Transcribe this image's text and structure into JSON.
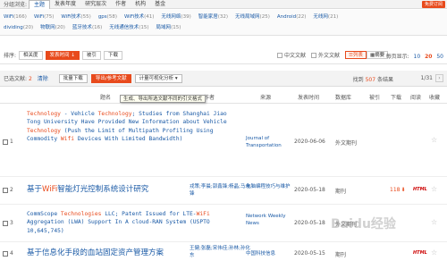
{
  "group_bar": {
    "label": "分组浏览:",
    "tabs": [
      "主题",
      "发表年度",
      "研究层次",
      "作者",
      "机构",
      "基金"
    ],
    "active": 0,
    "free_ordering": "免费订阅"
  },
  "facets": [
    [
      {
        "name": "WiFi",
        "count": "(166)"
      },
      {
        "name": "WiFi",
        "count": "(75)"
      },
      {
        "name": "WiFi技术",
        "count": "(55)"
      },
      {
        "name": "gps",
        "count": "(58)"
      },
      {
        "name": "WiFi技术",
        "count": "(41)"
      },
      {
        "name": "无线网络",
        "count": "(39)"
      },
      {
        "name": "智能家居",
        "count": "(32)"
      },
      {
        "name": "无线局域网",
        "count": "(25)"
      },
      {
        "name": "Android",
        "count": "(22)"
      },
      {
        "name": "无线网",
        "count": "(21)"
      }
    ],
    [
      {
        "name": "dividing",
        "count": "(20)"
      },
      {
        "name": "物联网",
        "count": "(20)"
      },
      {
        "name": "蓝牙技术",
        "count": "(16)"
      },
      {
        "name": "无线通信技术",
        "count": "(15)"
      },
      {
        "name": "局域网",
        "count": "(15)"
      }
    ]
  ],
  "sort_bar": {
    "label": "排序:",
    "buttons": [
      "相关度",
      "发表时间",
      "被引",
      "下载"
    ],
    "active": 1,
    "chinese_docs": "中文文献",
    "foreign_docs": "外文文献",
    "view_list": "列表",
    "view_abstract": "摘要",
    "per_page_label": "每页显示:",
    "per_page_options": [
      "10",
      "20",
      "50"
    ],
    "per_page_current": 1
  },
  "action_bar": {
    "selected_label": "已选文献:",
    "selected_count": "2",
    "clear": "清除",
    "buttons": [
      "批量下载",
      "导出/参考文献",
      "计量可视化分析 ▾"
    ],
    "active": 1,
    "found_prefix": "找到",
    "found_count": "507",
    "found_suffix": "条结果",
    "page": "1/31"
  },
  "tooltip": "生成、导出所选文献不同的引文格式",
  "table_header": {
    "title": "题名",
    "author": "作者",
    "source": "来源",
    "date": "发表时间",
    "db": "数据库",
    "cited": "被引",
    "downloads": "下载",
    "read": "阅读",
    "fav": "收藏"
  },
  "rows": [
    {
      "num": "1",
      "title_en": [
        "Technology",
        " - Vehicle ",
        "Technology",
        "; Studies from Shanghai Jiao Tong University Have Provided New Information about Vehicle ",
        "Technology",
        " (Push the Limit of Multipath Profiling Using Commodity ",
        "Wifi",
        " Devices With Limited Bandwidth)"
      ],
      "authors": "",
      "source": "Journal of Transportation",
      "date": "2020-06-06",
      "db": "外文期刊",
      "cited": "",
      "downloads": "",
      "html": false
    },
    {
      "num": "2",
      "title_cn": [
        "基于",
        "WiFi",
        "智能灯光控制系统设计研究"
      ],
      "authors": "戎策;李晨;郭鑫锋;杨晶;马永锋",
      "source": "电脑编程技巧与维护",
      "date": "2020-05-18",
      "db": "期刊",
      "cited": "",
      "downloads": "118",
      "html": true
    },
    {
      "num": "3",
      "title_en": [
        "CommScope ",
        "Technologies",
        " LLC; Patent Issued for LTE-",
        "WiFi",
        " Aggregation (LWA) Support In A cloud-RAN System (USPTO 10,645,745)"
      ],
      "authors": "",
      "source": "Network Weekly News",
      "date": "2020-05-18",
      "db": "外文期刊",
      "cited": "",
      "downloads": "",
      "html": false
    },
    {
      "num": "4",
      "title_cn": [
        "基于信息化手段的血站固定资产管理方案"
      ],
      "authors": "王健;张磊;宋伟佳;孙林;孙化东",
      "source": "中国科技信息",
      "date": "2020-05-15",
      "db": "期刊",
      "cited": "",
      "downloads": "",
      "html": true
    }
  ],
  "icons": {
    "checkbox": "checkbox-icon",
    "star": "star-icon",
    "download": "download-arrow-icon"
  },
  "watermark": "Baidu经验"
}
